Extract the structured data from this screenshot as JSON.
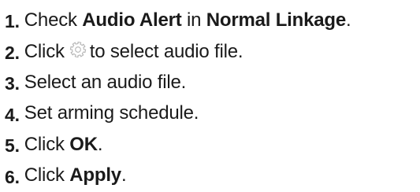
{
  "steps": [
    {
      "number": "1.",
      "parts": [
        {
          "text": "Check ",
          "bold": false
        },
        {
          "text": "Audio Alert",
          "bold": true
        },
        {
          "text": " in ",
          "bold": false
        },
        {
          "text": "Normal Linkage",
          "bold": true
        },
        {
          "text": ".",
          "bold": false
        }
      ]
    },
    {
      "number": "2.",
      "parts": [
        {
          "text": "Click",
          "bold": false
        },
        {
          "icon": "gear-icon"
        },
        {
          "text": "to select audio file.",
          "bold": false
        }
      ]
    },
    {
      "number": "3.",
      "parts": [
        {
          "text": "Select an audio file.",
          "bold": false
        }
      ]
    },
    {
      "number": "4.",
      "parts": [
        {
          "text": "Set arming schedule.",
          "bold": false
        }
      ]
    },
    {
      "number": "5.",
      "parts": [
        {
          "text": "Click ",
          "bold": false
        },
        {
          "text": "OK",
          "bold": true
        },
        {
          "text": ".",
          "bold": false
        }
      ]
    },
    {
      "number": "6.",
      "parts": [
        {
          "text": "Click ",
          "bold": false
        },
        {
          "text": "Apply",
          "bold": true
        },
        {
          "text": ".",
          "bold": false
        }
      ]
    }
  ],
  "colors": {
    "text": "#1a1a1a",
    "icon_stroke": "#b5b5b5"
  }
}
